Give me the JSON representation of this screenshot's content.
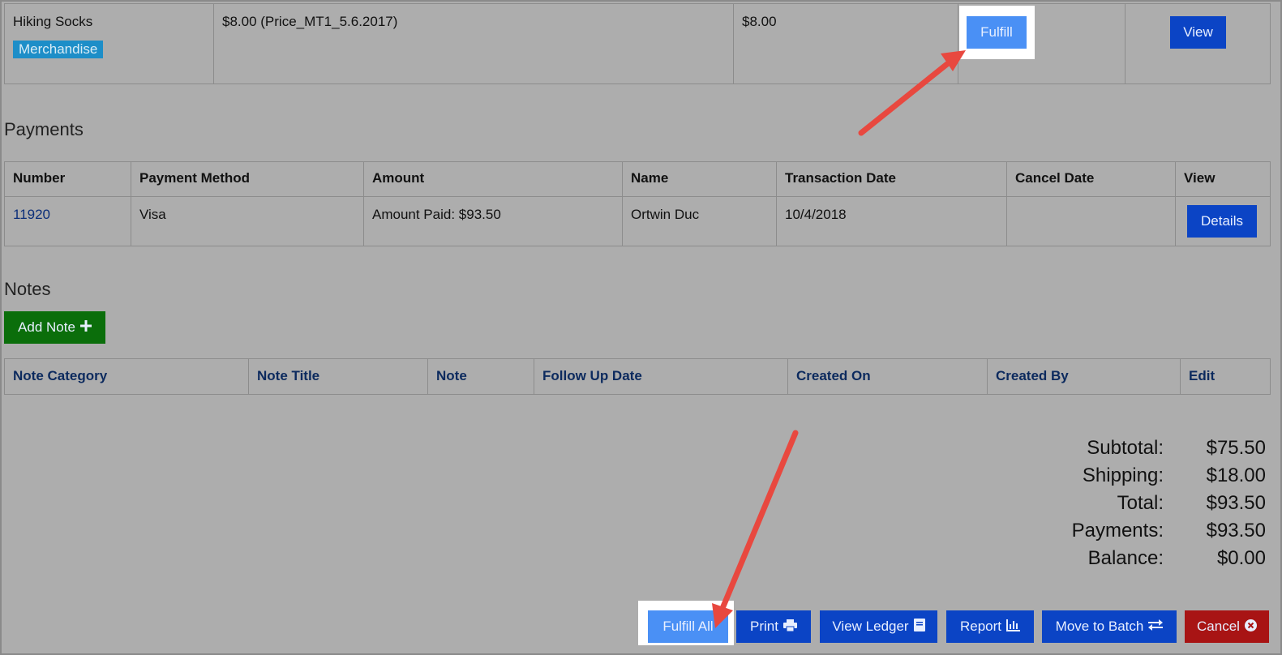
{
  "item_row": {
    "name": "Hiking Socks",
    "category_badge": "Merchandise",
    "price_desc": "$8.00 (Price_MT1_5.6.2017)",
    "amount": "$8.00",
    "fulfill_label": "Fulfill",
    "view_label": "View"
  },
  "payments": {
    "title": "Payments",
    "headers": [
      "Number",
      "Payment Method",
      "Amount",
      "Name",
      "Transaction Date",
      "Cancel Date",
      "View"
    ],
    "rows": [
      {
        "number": "11920",
        "method": "Visa",
        "amount": "Amount Paid: $93.50",
        "name": "Ortwin Duc",
        "transaction_date": "10/4/2018",
        "cancel_date": "",
        "details_label": "Details"
      }
    ]
  },
  "notes": {
    "title": "Notes",
    "add_label": "Add Note",
    "add_icon": "plus-icon",
    "headers": [
      "Note Category",
      "Note Title",
      "Note",
      "Follow Up Date",
      "Created On",
      "Created By",
      "Edit"
    ]
  },
  "totals": [
    {
      "label": "Subtotal:",
      "value": "$75.50"
    },
    {
      "label": "Shipping:",
      "value": "$18.00"
    },
    {
      "label": "Total:",
      "value": "$93.50"
    },
    {
      "label": "Payments:",
      "value": "$93.50"
    },
    {
      "label": "Balance:",
      "value": "$0.00"
    }
  ],
  "actions": {
    "fulfill_all": "Fulfill All",
    "print": "Print",
    "print_icon": "printer-icon",
    "view_ledger": "View Ledger",
    "view_ledger_icon": "book-icon",
    "report": "Report",
    "report_icon": "bar-chart-icon",
    "move_to_batch": "Move to Batch",
    "move_to_batch_icon": "exchange-icon",
    "cancel": "Cancel",
    "cancel_icon": "circle-x-icon"
  },
  "colors": {
    "page_bg": "#adadad",
    "primary_button": "#0b44c5",
    "highlighted_button": "#4a90f5",
    "add_note_button": "#0b6e0b",
    "cancel_button": "#a81414",
    "annotation_arrow": "#e8483f",
    "badge": "#1d8ec8"
  }
}
